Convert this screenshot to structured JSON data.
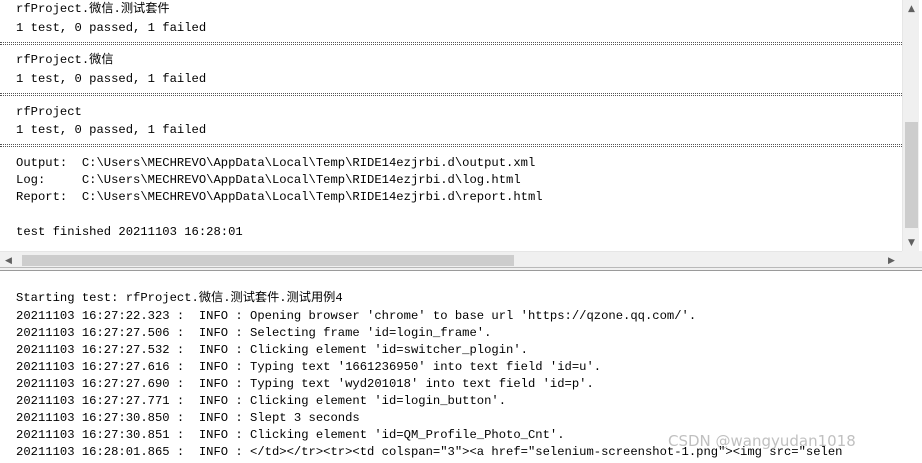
{
  "top_output": {
    "lines": [
      "rfProject.微信.测试套件",
      "1 test, 0 passed, 1 failed",
      "rfProject.微信",
      "1 test, 0 passed, 1 failed",
      "rfProject",
      "1 test, 0 passed, 1 failed",
      "Output:  C:\\Users\\MECHREVO\\AppData\\Local\\Temp\\RIDE14ezjrbi.d\\output.xml",
      "Log:     C:\\Users\\MECHREVO\\AppData\\Local\\Temp\\RIDE14ezjrbi.d\\log.html",
      "Report:  C:\\Users\\MECHREVO\\AppData\\Local\\Temp\\RIDE14ezjrbi.d\\report.html",
      "test finished 20211103 16:28:01"
    ]
  },
  "bottom_log": {
    "lines": [
      "Starting test: rfProject.微信.测试套件.测试用例4",
      "20211103 16:27:22.323 :  INFO : Opening browser 'chrome' to base url 'https://qzone.qq.com/'.",
      "20211103 16:27:27.506 :  INFO : Selecting frame 'id=login_frame'.",
      "20211103 16:27:27.532 :  INFO : Clicking element 'id=switcher_plogin'.",
      "20211103 16:27:27.616 :  INFO : Typing text '1661236950' into text field 'id=u'.",
      "20211103 16:27:27.690 :  INFO : Typing text 'wyd201018' into text field 'id=p'.",
      "20211103 16:27:27.771 :  INFO : Clicking element 'id=login_button'.",
      "20211103 16:27:30.850 :  INFO : Slept 3 seconds",
      "20211103 16:27:30.851 :  INFO : Clicking element 'id=QM_Profile_Photo_Cnt'.",
      "20211103 16:28:01.865 :  INFO : </td></tr><tr><td colspan=\"3\"><a href=\"selenium-screenshot-1.png\"><img src=\"selen"
    ]
  },
  "watermark": "CSDN @wangyudan1018",
  "icons": {
    "scroll_up": "scroll-up-arrow-icon",
    "scroll_down": "scroll-down-arrow-icon",
    "scroll_left": "scroll-left-arrow-icon",
    "scroll_right": "scroll-right-arrow-icon"
  }
}
